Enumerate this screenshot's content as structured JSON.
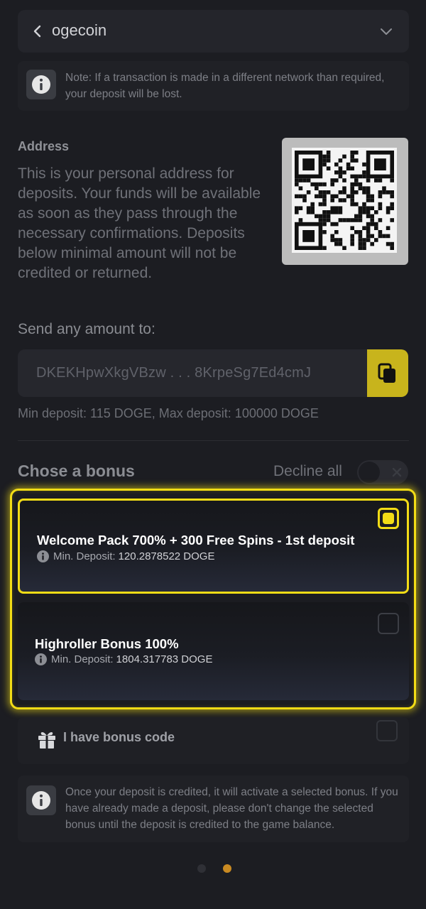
{
  "currency": {
    "name": "ogecoin"
  },
  "network_note": "Note: If a transaction is made in a different network than required, your deposit will be lost.",
  "address": {
    "heading": "Address",
    "description": "This is your personal address for deposits. Your funds will be available as soon as they pass through the necessary confirmations. Deposits below minimal amount will not be credited or returned.",
    "send_label": "Send any amount to:",
    "value": "DKEKHpwXkgVBzw . . . 8KrpeSg7Ed4cmJ",
    "limits": "Min deposit: 115 DOGE, Max deposit: 100000 DOGE"
  },
  "bonus": {
    "heading": "Chose a bonus",
    "decline_label": "Decline all",
    "decline_on": false,
    "options": [
      {
        "title": "Welcome Pack 700% + 300 Free Spins - 1st deposit",
        "min_label": "Min. Deposit:",
        "min_value": "120.2878522 DOGE",
        "selected": true
      },
      {
        "title": "Highroller Bonus 100%",
        "min_label": "Min. Deposit:",
        "min_value": "1804.317783 DOGE",
        "selected": false
      }
    ],
    "code_label": "I have bonus code"
  },
  "bonus_note": "Once your deposit is credited, it will activate a selected bonus. If you have already made a deposit, please don't change the selected bonus until the deposit is credited to the game balance.",
  "pager": {
    "pages": 2,
    "active": 2
  },
  "colors": {
    "accent": "#f2dc16",
    "copy_button": "#c8b41c",
    "active_dot": "#c98a22"
  }
}
